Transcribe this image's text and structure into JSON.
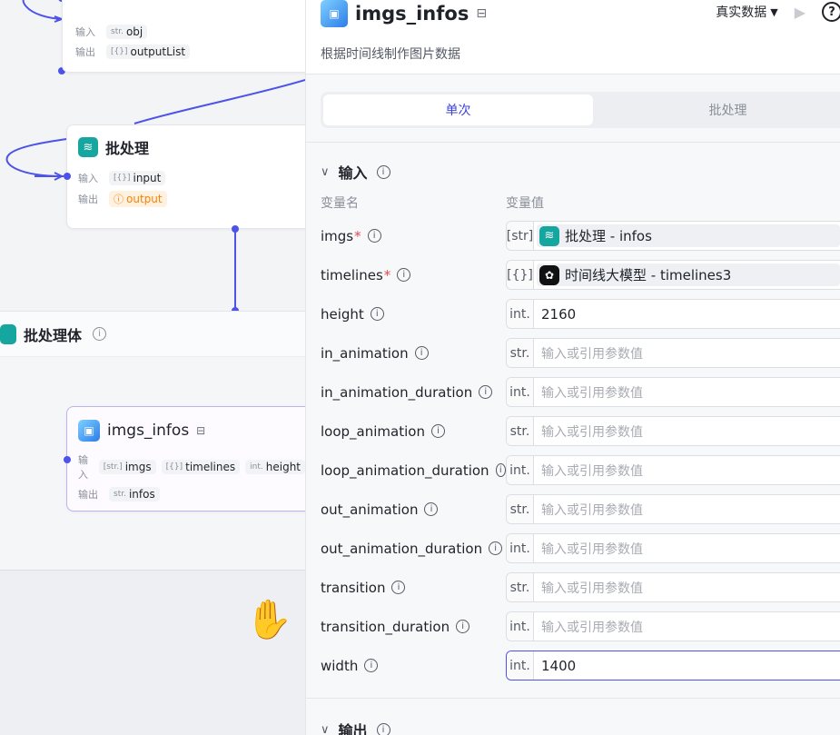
{
  "canvas": {
    "node_top": {
      "inputs_label": "输入",
      "outputs_label": "输出",
      "input_type": "str.",
      "input_name": "obj",
      "output_type": "[{}]",
      "output_name": "outputList"
    },
    "node_batch": {
      "title": "批处理",
      "inputs_label": "输入",
      "outputs_label": "输出",
      "input_type": "[{}]",
      "input_name": "input",
      "output_name": "output"
    },
    "batch_body": {
      "title": "批处理体"
    },
    "node_imgs": {
      "title": "imgs_infos",
      "inputs_label": "输入",
      "outputs_label": "输出",
      "inputs": [
        {
          "type": "[str.]",
          "name": "imgs"
        },
        {
          "type": "[{}]",
          "name": "timelines"
        },
        {
          "type": "int.",
          "name": "height"
        }
      ],
      "output_type": "str.",
      "output_name": "infos"
    }
  },
  "panel": {
    "title": "imgs_infos",
    "description": "根据时间线制作图片数据",
    "data_mode": "真实数据",
    "tabs": [
      {
        "label": "单次",
        "active": true
      },
      {
        "label": "批处理",
        "active": false
      }
    ],
    "input_section": "输入",
    "col_name": "变量名",
    "col_value": "变量值",
    "params": [
      {
        "name": "imgs",
        "required": true,
        "type": "[str]",
        "kind": "ref",
        "ref_text": "批处理 - infos",
        "ref_icon": "layers-icon"
      },
      {
        "name": "timelines",
        "required": true,
        "type": "[{}]",
        "kind": "ref",
        "ref_text": "时间线大模型 - timelines3",
        "ref_icon": "llm-icon"
      },
      {
        "name": "height",
        "required": false,
        "type": "int.",
        "kind": "value",
        "value": "2160"
      },
      {
        "name": "in_animation",
        "required": false,
        "type": "str.",
        "kind": "placeholder",
        "value": "输入或引用参数值"
      },
      {
        "name": "in_animation_duration",
        "required": false,
        "type": "int.",
        "kind": "placeholder",
        "value": "输入或引用参数值"
      },
      {
        "name": "loop_animation",
        "required": false,
        "type": "str.",
        "kind": "placeholder",
        "value": "输入或引用参数值"
      },
      {
        "name": "loop_animation_duration",
        "required": false,
        "type": "int.",
        "kind": "placeholder",
        "value": "输入或引用参数值"
      },
      {
        "name": "out_animation",
        "required": false,
        "type": "str.",
        "kind": "placeholder",
        "value": "输入或引用参数值"
      },
      {
        "name": "out_animation_duration",
        "required": false,
        "type": "int.",
        "kind": "placeholder",
        "value": "输入或引用参数值"
      },
      {
        "name": "transition",
        "required": false,
        "type": "str.",
        "kind": "placeholder",
        "value": "输入或引用参数值"
      },
      {
        "name": "transition_duration",
        "required": false,
        "type": "int.",
        "kind": "placeholder",
        "value": "输入或引用参数值"
      },
      {
        "name": "width",
        "required": false,
        "type": "int.",
        "kind": "value",
        "value": "1400",
        "focused": true
      }
    ],
    "output_section": "输出"
  },
  "colors": {
    "accent": "#4d53e8",
    "teal": "#16a6a0",
    "warning": "#f5830a",
    "required": "#e5484d"
  }
}
